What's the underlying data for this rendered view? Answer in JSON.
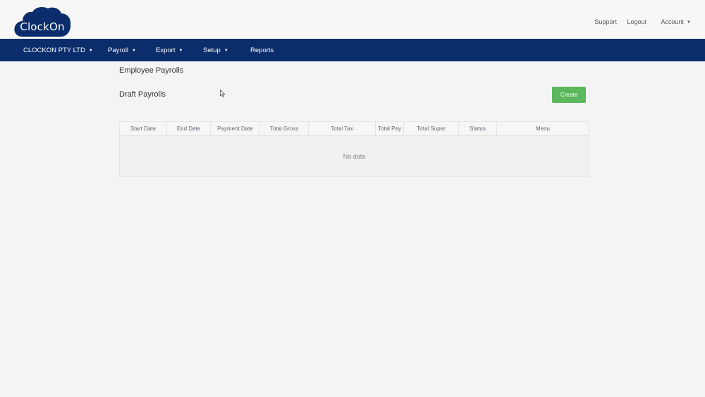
{
  "header": {
    "logo_text": "ClockOn",
    "links": {
      "support": "Support",
      "logout": "Logout",
      "account": "Account"
    }
  },
  "nav": {
    "company": "CLOCKON PTY LTD",
    "payroll": "Payroll",
    "export": "Export",
    "setup": "Setup",
    "reports": "Reports"
  },
  "main": {
    "page_title": "Employee Payrolls",
    "section_title": "Draft Payrolls",
    "create_label": "Create"
  },
  "table": {
    "columns": [
      "Start Date",
      "End Date",
      "Payment Date",
      "Total Gross",
      "Total Tax",
      "Total Pay",
      "Total Super",
      "Status",
      "Menu"
    ],
    "empty_text": "No data"
  },
  "colors": {
    "nav_bg": "#0b2d6b",
    "create_button": "#5cb85c"
  }
}
